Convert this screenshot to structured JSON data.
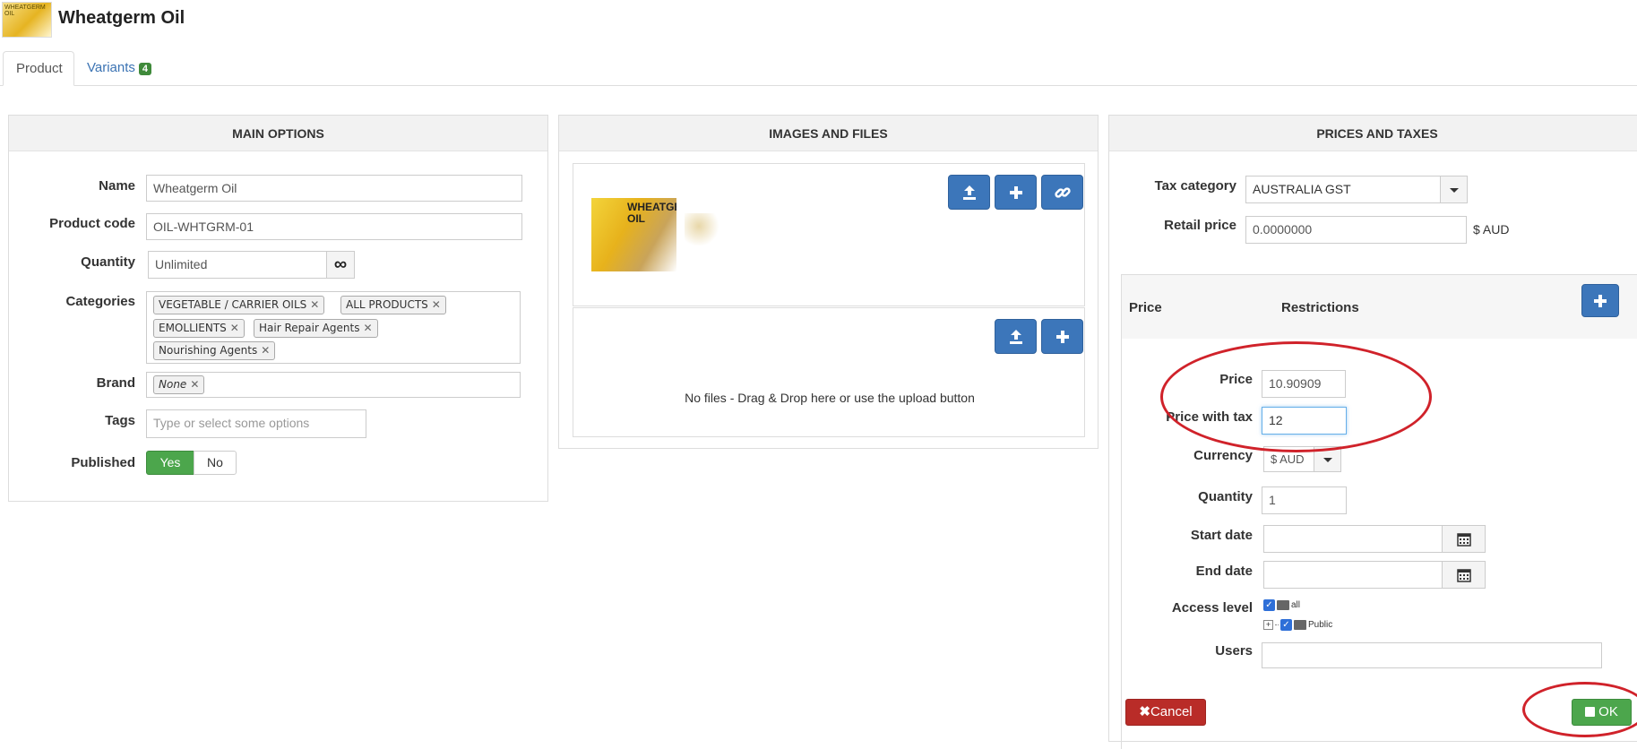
{
  "header": {
    "logo_text": "WHEATGERM OIL",
    "title": "Wheatgerm Oil"
  },
  "tabs": [
    {
      "label": "Product"
    },
    {
      "label": "Variants",
      "badge": "4"
    }
  ],
  "main_options": {
    "heading": "MAIN OPTIONS",
    "name_label": "Name",
    "name_value": "Wheatgerm Oil",
    "code_label": "Product code",
    "code_value": "OIL-WHTGRM-01",
    "quantity_label": "Quantity",
    "quantity_value": "Unlimited",
    "categories_label": "Categories",
    "categories": [
      "VEGETABLE / CARRIER OILS",
      "ALL PRODUCTS",
      "EMOLLIENTS",
      "Hair Repair Agents",
      "Nourishing Agents"
    ],
    "brand_label": "Brand",
    "brand_value": "None",
    "tags_label": "Tags",
    "tags_placeholder": "Type or select some options",
    "published_label": "Published",
    "yes_label": "Yes",
    "no_label": "No"
  },
  "images_files": {
    "heading": "IMAGES AND FILES",
    "image_text": "WHEATGERM OIL",
    "no_files_text": "No files - Drag & Drop here or use the upload button"
  },
  "prices_taxes": {
    "heading": "PRICES AND TAXES",
    "tax_category_label": "Tax category",
    "tax_category_value": "AUSTRALIA GST",
    "retail_price_label": "Retail price",
    "retail_price_value": "0.0000000",
    "retail_currency": "$ AUD",
    "table_price_header": "Price",
    "table_restrictions_header": "Restrictions",
    "form": {
      "price_label": "Price",
      "price_value": "10.90909",
      "price_tax_label": "Price with tax",
      "price_tax_value": "12",
      "currency_label": "Currency",
      "currency_value": "$ AUD",
      "quantity_label": "Quantity",
      "quantity_value": "1",
      "start_date_label": "Start date",
      "end_date_label": "End date",
      "access_label": "Access level",
      "access_all": "all",
      "access_public": "Public",
      "users_label": "Users",
      "cancel_label": "Cancel",
      "ok_label": "OK"
    }
  },
  "colors": {
    "primary_blue": "#3c76ba",
    "success_green": "#4ca64c",
    "danger_red": "#b92c28",
    "annotation_red": "#d0222a"
  }
}
